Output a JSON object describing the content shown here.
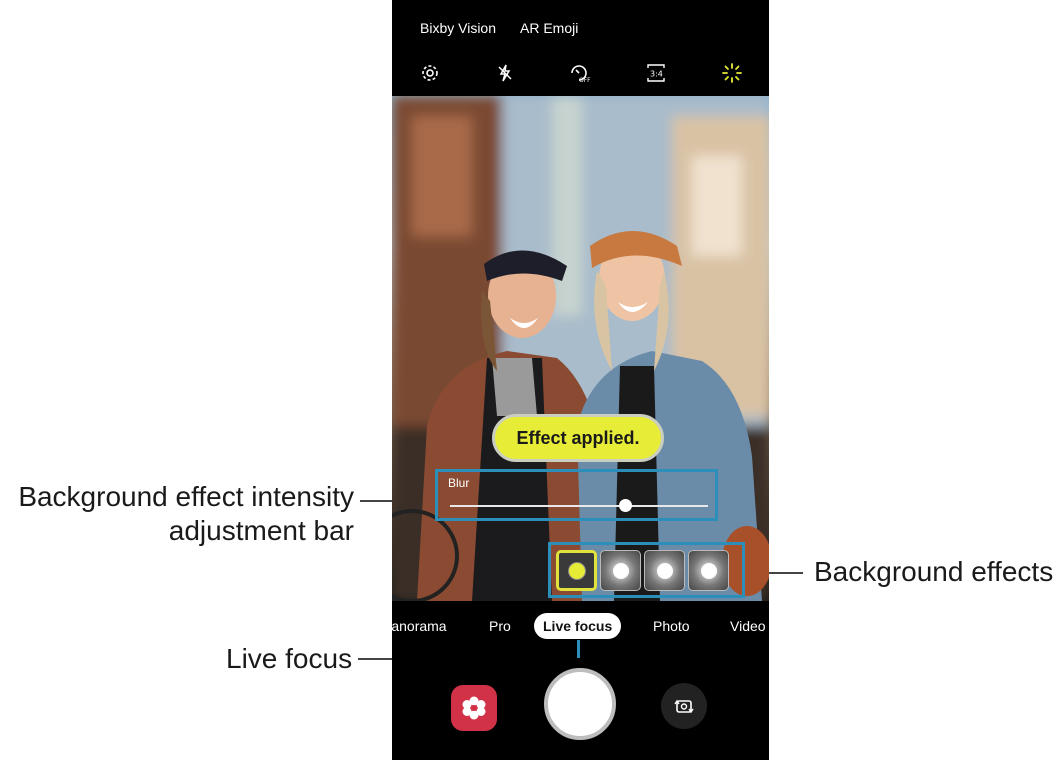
{
  "top_bar": {
    "bixby_vision": "Bixby Vision",
    "ar_emoji": "AR Emoji"
  },
  "top_icons": [
    "settings-icon",
    "flash-off-icon",
    "timer-off-icon",
    "aspect-ratio-icon",
    "filter-effect-icon"
  ],
  "timer_icon_text": "OFF",
  "ratio_text": "3:4",
  "toast": "Effect applied.",
  "blur": {
    "label": "Blur",
    "level": 0.68
  },
  "effects": {
    "count": 4,
    "selected_index": 0
  },
  "modes": {
    "panorama": "Panorama",
    "pro": "Pro",
    "live_focus": "Live focus",
    "photo": "Photo",
    "video": "Video"
  },
  "callouts": {
    "bg_intensity_line1": "Background effect intensity",
    "bg_intensity_line2": "adjustment bar",
    "live_focus": "Live focus",
    "bg_effects": "Background effects"
  },
  "colors": {
    "callout_line": "#2b8fb9",
    "toast_bg": "#e7ec37",
    "gallery_bg": "#d23247"
  }
}
